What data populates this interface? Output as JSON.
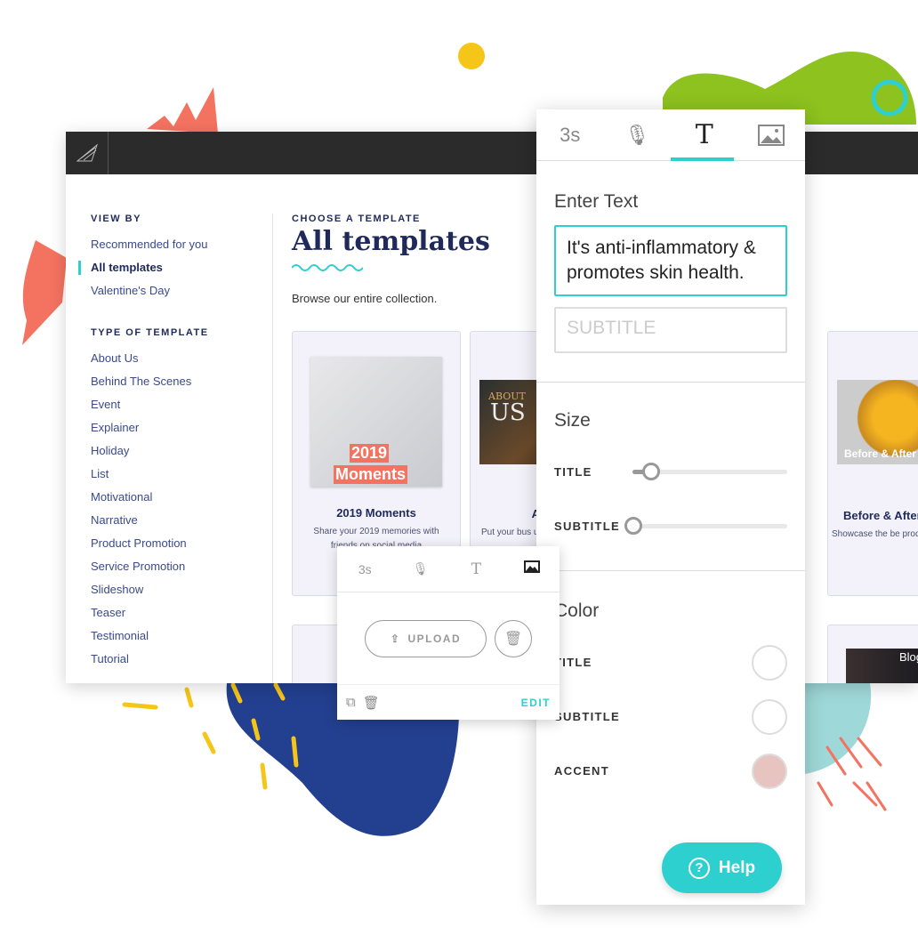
{
  "header": {
    "logo": "app-logo"
  },
  "sidebar": {
    "view_by_heading": "VIEW BY",
    "view_by": [
      "Recommended for you",
      "All templates",
      "Valentine's Day"
    ],
    "type_heading": "TYPE OF TEMPLATE",
    "types": [
      "About Us",
      "Behind The Scenes",
      "Event",
      "Explainer",
      "Holiday",
      "List",
      "Motivational",
      "Narrative",
      "Product Promotion",
      "Service Promotion",
      "Slideshow",
      "Teaser",
      "Testimonial",
      "Tutorial"
    ]
  },
  "main": {
    "eyebrow": "CHOOSE A TEMPLATE",
    "title": "All templates",
    "subtitle": "Browse our entire collection.",
    "cards": [
      {
        "image_text_1": "2019",
        "image_text_2": "Moments",
        "title": "2019 Moments",
        "desc": "Share your 2019 memories with friends on social media"
      },
      {
        "image_text_1": "ABOUT",
        "image_text_2": "US",
        "title": "A",
        "desc": "Put your bus using elegan"
      },
      {
        "image_text_1": "Before & After",
        "title": "Before & After",
        "desc": "Showcase the be product or service before-and-a"
      },
      {
        "image_text_1": "Blog"
      }
    ]
  },
  "editor": {
    "tabs": [
      "3s",
      "mic-icon",
      "text-icon",
      "image-icon"
    ],
    "active_tab": "text",
    "enter_text_label": "Enter Text",
    "title_value": "It's anti-inflammatory & promotes skin health.",
    "subtitle_placeholder": "SUBTITLE",
    "size_heading": "Size",
    "size_title_label": "TITLE",
    "size_title_value": 0.08,
    "size_subtitle_label": "SUBTITLE",
    "size_subtitle_value": 0,
    "color_heading": "Color",
    "color_title_label": "TITLE",
    "color_title": "#ffffff",
    "color_subtitle_label": "SUBTITLE",
    "color_subtitle": "#ffffff",
    "color_accent_label": "ACCENT",
    "color_accent": "#e8c4c0",
    "help_label": "Help"
  },
  "popup": {
    "tabs": [
      "3s",
      "mic-icon",
      "text-icon",
      "image-icon"
    ],
    "active_tab": "image",
    "upload_label": "UPLOAD",
    "edit_label": "EDIT"
  },
  "colors": {
    "accent": "#2ecfcf",
    "navy": "#1f2a5a"
  }
}
